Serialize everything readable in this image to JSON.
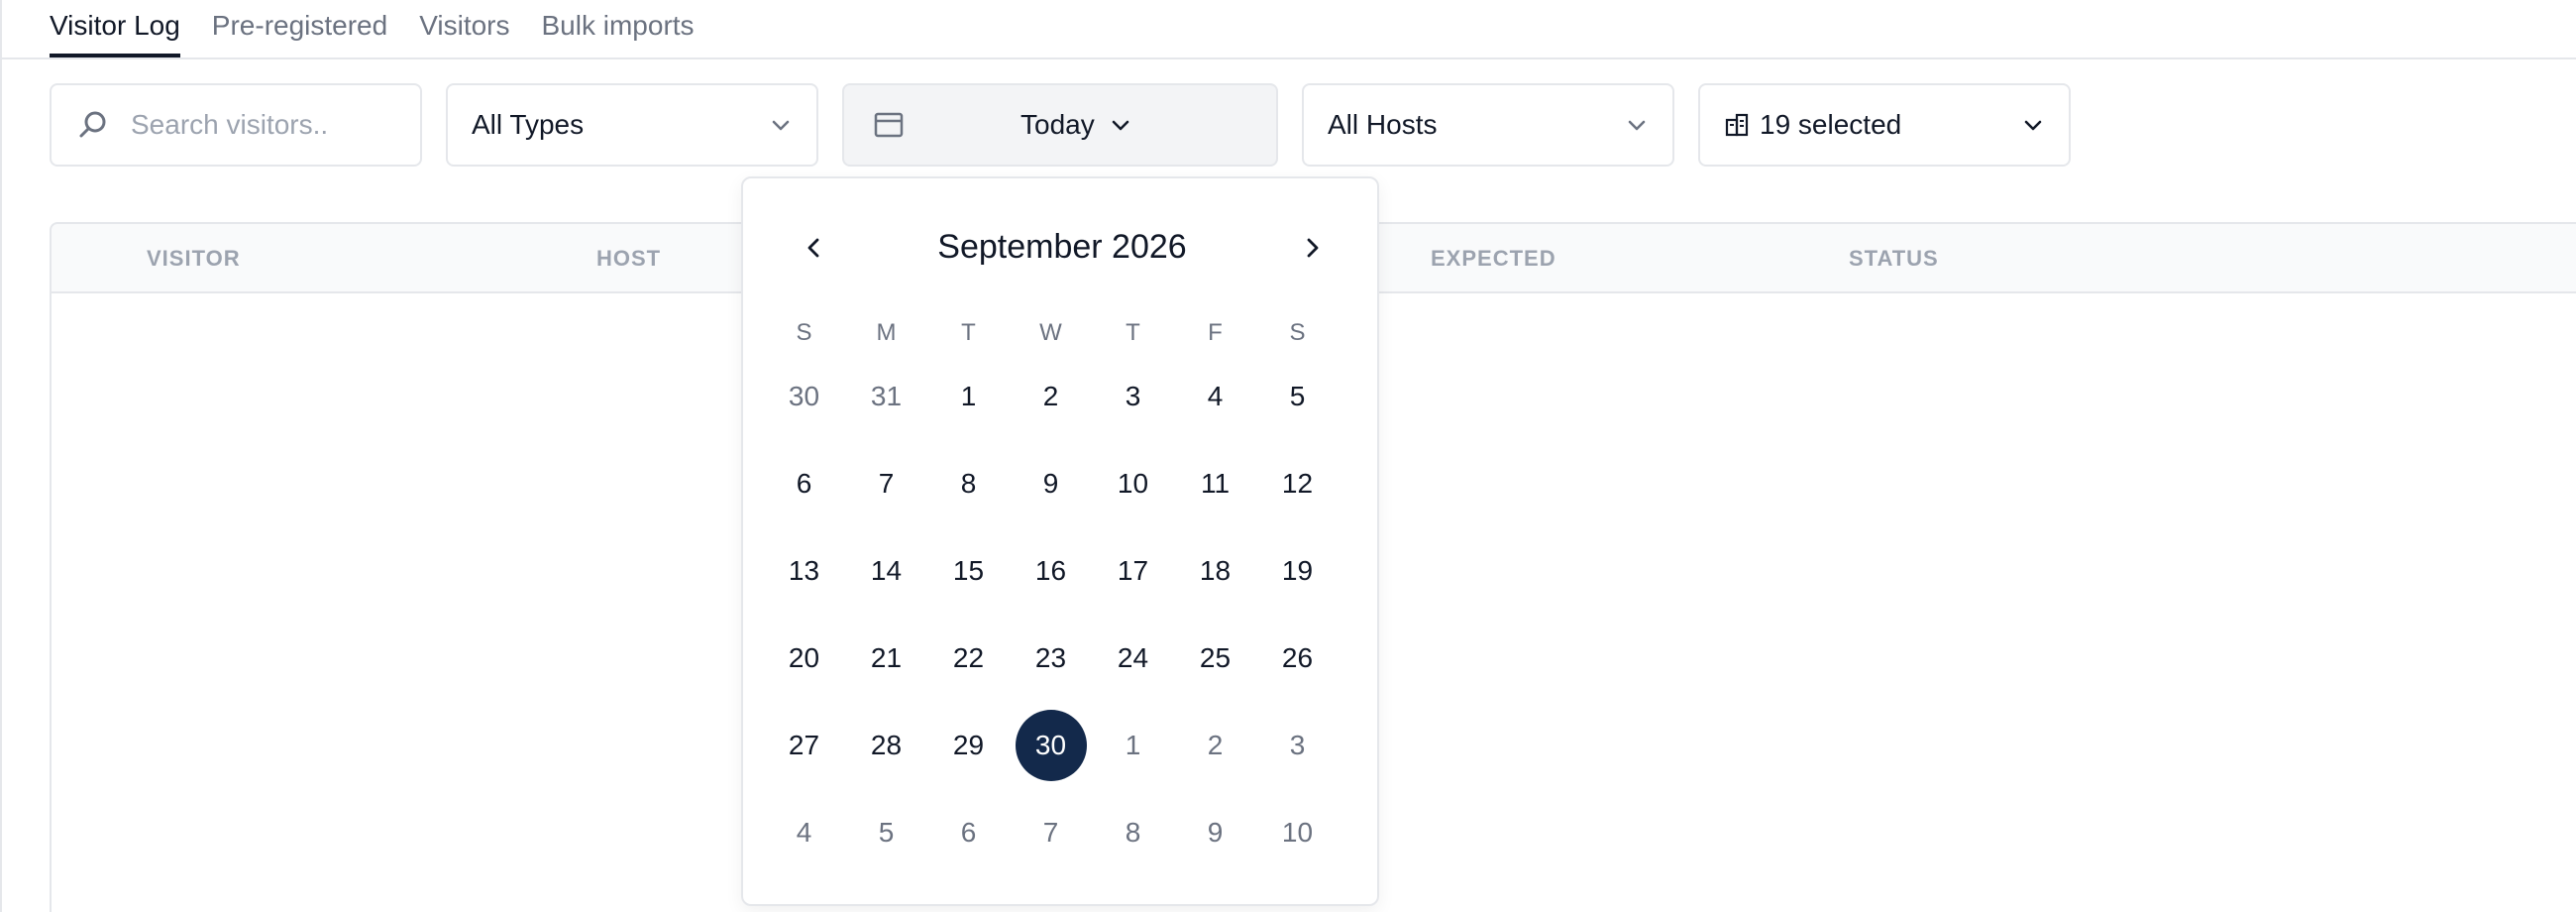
{
  "tabs": [
    {
      "label": "Visitor Log",
      "active": true
    },
    {
      "label": "Pre-registered",
      "active": false
    },
    {
      "label": "Visitors",
      "active": false
    },
    {
      "label": "Bulk imports",
      "active": false
    }
  ],
  "filters": {
    "search_placeholder": "Search visitors..",
    "types_value": "All Types",
    "date_value": "Today",
    "hosts_value": "All Hosts",
    "sites_value": "19 selected"
  },
  "table": {
    "columns": [
      "VISITOR",
      "HOST",
      "EXPECTED",
      "STATUS"
    ]
  },
  "calendar": {
    "title": "September 2026",
    "weekdays": [
      "S",
      "M",
      "T",
      "W",
      "T",
      "F",
      "S"
    ],
    "weeks": [
      [
        {
          "d": "30",
          "muted": true
        },
        {
          "d": "31",
          "muted": true
        },
        {
          "d": "1"
        },
        {
          "d": "2"
        },
        {
          "d": "3"
        },
        {
          "d": "4"
        },
        {
          "d": "5"
        }
      ],
      [
        {
          "d": "6"
        },
        {
          "d": "7"
        },
        {
          "d": "8"
        },
        {
          "d": "9"
        },
        {
          "d": "10"
        },
        {
          "d": "11"
        },
        {
          "d": "12"
        }
      ],
      [
        {
          "d": "13"
        },
        {
          "d": "14"
        },
        {
          "d": "15"
        },
        {
          "d": "16"
        },
        {
          "d": "17"
        },
        {
          "d": "18"
        },
        {
          "d": "19"
        }
      ],
      [
        {
          "d": "20"
        },
        {
          "d": "21"
        },
        {
          "d": "22"
        },
        {
          "d": "23"
        },
        {
          "d": "24"
        },
        {
          "d": "25"
        },
        {
          "d": "26"
        }
      ],
      [
        {
          "d": "27"
        },
        {
          "d": "28"
        },
        {
          "d": "29"
        },
        {
          "d": "30",
          "selected": true
        },
        {
          "d": "1",
          "muted": true
        },
        {
          "d": "2",
          "muted": true
        },
        {
          "d": "3",
          "muted": true
        }
      ],
      [
        {
          "d": "4",
          "muted": true
        },
        {
          "d": "5",
          "muted": true
        },
        {
          "d": "6",
          "muted": true
        },
        {
          "d": "7",
          "muted": true
        },
        {
          "d": "8",
          "muted": true
        },
        {
          "d": "9",
          "muted": true
        },
        {
          "d": "10",
          "muted": true
        }
      ]
    ]
  },
  "colors": {
    "selected_day_bg": "#13294b",
    "active_tab": "#111827",
    "muted_text": "#6b7280"
  }
}
